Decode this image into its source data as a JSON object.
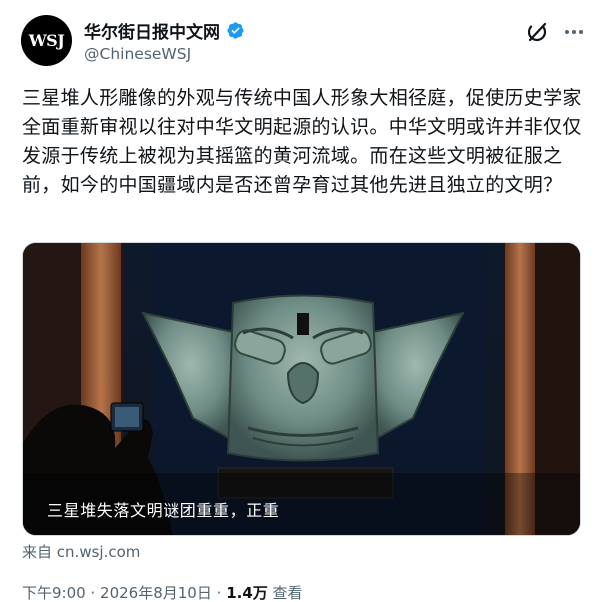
{
  "author": {
    "display_name": "华尔街日报中文网",
    "handle": "@ChineseWSJ",
    "avatar_text": "WSJ",
    "verified": true
  },
  "tweet": {
    "text": "三星堆人形雕像的外观与传统中国人形象大相径庭，促使历史学家全面重新审视以往对中华文明起源的认识。中华文明或许并非仅仅发源于传统上被视为其摇篮的黄河流域。而在这些文明被征服之前，如今的中国疆域内是否还曾孕育过其他先进且独立的文明？"
  },
  "media": {
    "caption": "三星堆失落文明谜团重重，正重"
  },
  "source": {
    "prefix": "来自",
    "domain": "cn.wsj.com"
  },
  "meta": {
    "time": "下午9:00",
    "date": "2026年8月10日",
    "separator": "·",
    "views_count": "1.4万",
    "views_label": "查看"
  },
  "colors": {
    "verified_blue": "#1d9bf0",
    "text_primary": "#0f1419",
    "text_secondary": "#536471"
  },
  "icons": {
    "grok": "grok-icon",
    "more": "more-icon",
    "verified": "verified-badge-icon"
  }
}
